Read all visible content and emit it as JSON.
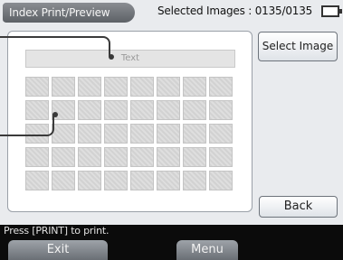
{
  "header": {
    "title": "Index Print/Preview",
    "selected_images": "Selected Images : 0135/0135"
  },
  "preview": {
    "text_bar_label": "Text",
    "thumbnail_count": 40
  },
  "buttons": {
    "select_image": "Select Image",
    "back": "Back"
  },
  "status": {
    "message": "Press [PRINT] to print."
  },
  "soft_keys": {
    "exit": "Exit",
    "menu": "Menu"
  },
  "icons": {
    "battery": "battery-icon"
  },
  "colors": {
    "pill": "#6e7277",
    "status_bar": "#0b0b0b"
  }
}
